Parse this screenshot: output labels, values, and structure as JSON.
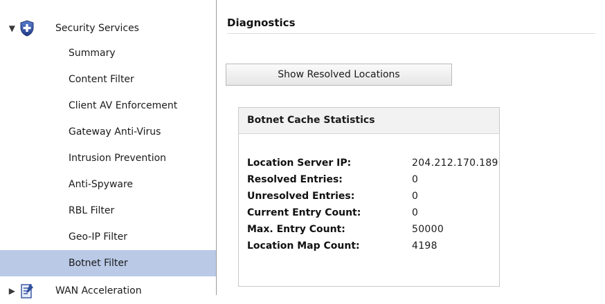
{
  "sidebar": {
    "group": {
      "label": "Security Services",
      "expanded": true,
      "icon": "shield-icon"
    },
    "items": [
      {
        "label": "Summary"
      },
      {
        "label": "Content Filter"
      },
      {
        "label": "Client AV Enforcement"
      },
      {
        "label": "Gateway Anti-Virus"
      },
      {
        "label": "Intrusion Prevention"
      },
      {
        "label": "Anti-Spyware"
      },
      {
        "label": "RBL Filter"
      },
      {
        "label": "Geo-IP Filter"
      },
      {
        "label": "Botnet Filter",
        "active": true
      }
    ],
    "next_group": {
      "label": "WAN Acceleration",
      "expanded": false,
      "icon": "document-edit-icon"
    }
  },
  "main": {
    "title": "Diagnostics",
    "button_label": "Show Resolved Locations",
    "panel": {
      "title": "Botnet Cache Statistics",
      "rows": [
        {
          "label": "Location Server IP:",
          "value": "204.212.170.189"
        },
        {
          "label": "Resolved Entries:",
          "value": "0"
        },
        {
          "label": "Unresolved Entries:",
          "value": "0"
        },
        {
          "label": "Current Entry Count:",
          "value": "0"
        },
        {
          "label": "Max. Entry Count:",
          "value": "50000"
        },
        {
          "label": "Location Map Count:",
          "value": "4198"
        }
      ]
    }
  },
  "colors": {
    "active_item_bg": "#b9c9e6",
    "shield_blue": "#2f4f9e"
  }
}
